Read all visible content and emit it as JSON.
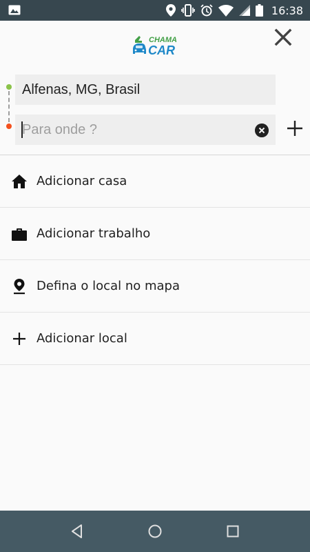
{
  "status_bar": {
    "time": "16:38",
    "icons": [
      "image-icon",
      "location-icon",
      "vibrate-icon",
      "alarm-icon",
      "wifi-icon",
      "signal-icon",
      "battery-icon"
    ]
  },
  "header": {
    "logo_text_top": "CHAMA",
    "logo_text_bottom": "CAR",
    "close_icon": "close-icon"
  },
  "route": {
    "origin_value": "Alfenas, MG, Brasil",
    "destination_value": "",
    "destination_placeholder": "Para onde ?"
  },
  "list": {
    "items": [
      {
        "icon": "home-icon",
        "label": "Adicionar casa"
      },
      {
        "icon": "briefcase-icon",
        "label": "Adicionar trabalho"
      },
      {
        "icon": "map-pin-icon",
        "label": "Defina o local no mapa"
      },
      {
        "icon": "plus-icon",
        "label": "Adicionar local"
      }
    ]
  },
  "nav_bar": {
    "buttons": [
      "back-icon",
      "home-circle-icon",
      "recents-icon"
    ]
  },
  "colors": {
    "status_bar": "#37474f",
    "nav_bar": "#455a64",
    "route_start": "#8bc34a",
    "route_end": "#f4511e",
    "logo_primary": "#1e88c8",
    "logo_accent": "#43a047"
  }
}
